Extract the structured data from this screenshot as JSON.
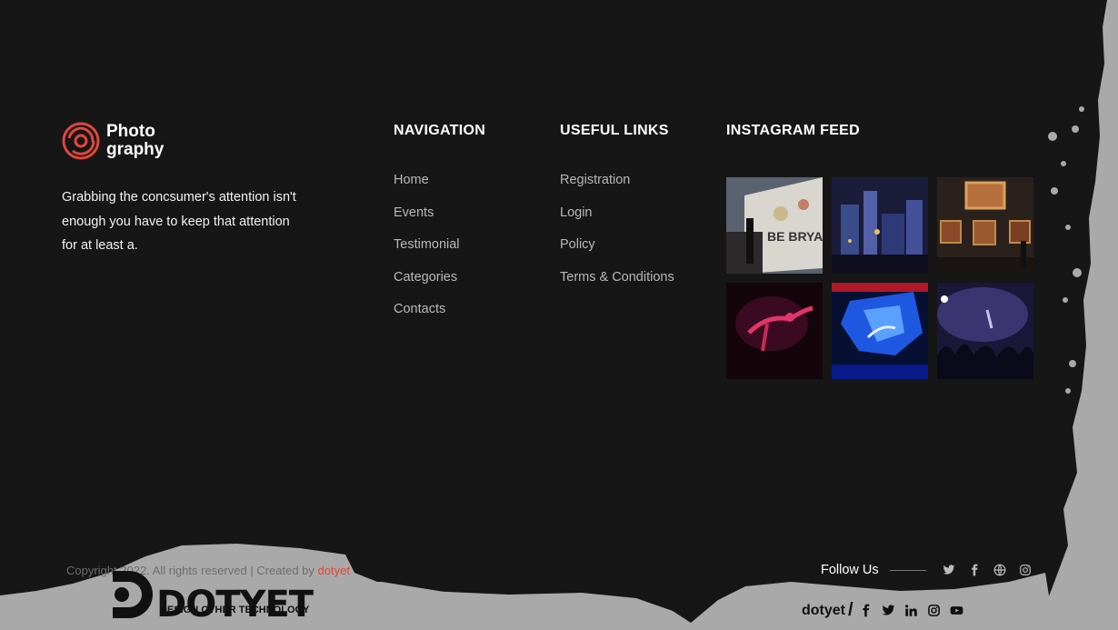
{
  "brand": {
    "line1": "Photo",
    "line2": "graphy",
    "accent": "#e0473a"
  },
  "about": {
    "text": "Grabbing the concsumer's attention isn't enough you have to keep that attention for at least a."
  },
  "navigation": {
    "title": "NAVIGATION",
    "items": [
      "Home",
      "Events",
      "Testimonial",
      "Categories",
      "Contacts"
    ]
  },
  "useful_links": {
    "title": "USEFUL LINKS",
    "items": [
      "Registration",
      "Login",
      "Policy",
      "Terms & Conditions"
    ]
  },
  "instagram": {
    "title": "INSTAGRAM FEED",
    "icons": [
      "photo-wall-mural",
      "city-model",
      "gallery-paintings",
      "red-dancer",
      "blue-stage",
      "concert-crowd"
    ]
  },
  "footer": {
    "copyright": "Copyright 2022. All rights reserved | Created by",
    "creator": "dotyet",
    "follow_label": "Follow Us",
    "social_icons": [
      "twitter-icon",
      "facebook-icon",
      "globe-icon",
      "instagram-icon"
    ]
  },
  "watermark": {
    "title": "DOTYET",
    "subtitle": "DESIGN OTHER TECHNOLOGY",
    "name": "dotyet",
    "slash": "/",
    "icons": [
      "facebook-icon",
      "twitter-icon",
      "linkedin-icon",
      "instagram-icon",
      "youtube-icon"
    ]
  },
  "colors": {
    "background": "#161617",
    "link": "#b9b9b9",
    "grunge": "#a9a9a9"
  }
}
